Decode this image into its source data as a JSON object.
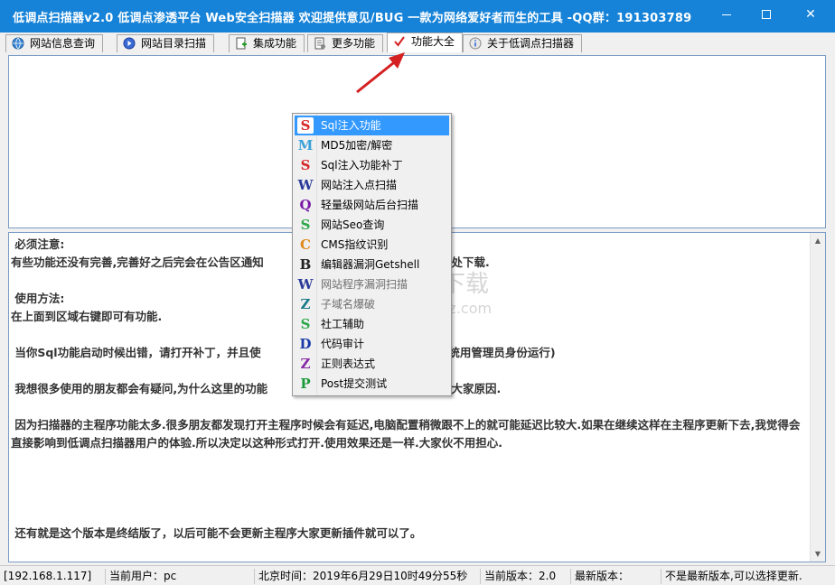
{
  "window": {
    "title": "低调点扫描器v2.0 低调点渗透平台 Web安全扫描器 欢迎提供意见/BUG  一款为网络爱好者而生的工具   -QQ群：191303789"
  },
  "tabs": [
    {
      "label": "网站信息查询",
      "icon": "globe-icon"
    },
    {
      "label": "网站目录扫描",
      "icon": "play-circle-icon"
    },
    {
      "label": "集成功能",
      "icon": "document-add-icon"
    },
    {
      "label": "更多功能",
      "icon": "document-gear-icon"
    },
    {
      "label": "功能大全",
      "icon": "checkmark-icon",
      "active": true
    },
    {
      "label": "关于低调点扫描器",
      "icon": "info-icon"
    }
  ],
  "notice": {
    "text": " 必须注意:\n有些功能还没有完善,完善好之后完会在公告区通知                                          更新处下载.\n\n 使用方法:\n在上面到区域右键即可有功能.\n\n 当你Sql功能启动时候出错，请打开补丁，并且使                                          上系统用管理员身份运行)\n\n 我想很多使用的朋友都会有疑问,为什么这里的功能                                         告诉大家原因.\n\n 因为扫描器的主程序功能太多.很多朋友都发现打开主程序时候会有延迟,电脑配置稍微跟不上的就可能延迟比较大.如果在继续这样在主程序更新下去,我觉得会直接影响到低调点扫描器用户的体验.所以决定以这种形式打开.使用效果还是一样.大家伙不用担心.\n\n\n\n\n 还有就是这个版本是终结版了，以后可能不会更新主程序大家更新插件就可以了。"
  },
  "context_menu": {
    "items": [
      {
        "label": "Sql注入功能",
        "icon": "s-letter-icon",
        "glyph": "S",
        "color": "#d62828",
        "highlighted": true
      },
      {
        "label": "MD5加密/解密",
        "icon": "m-letter-icon",
        "glyph": "M",
        "color": "#3aa0d8"
      },
      {
        "label": "Sql注入功能补丁",
        "icon": "s-letter-icon",
        "glyph": "S",
        "color": "#d62828"
      },
      {
        "label": "网站注入点扫描",
        "icon": "w-letter-icon",
        "glyph": "W",
        "color": "#2a3a9a"
      },
      {
        "label": "轻量级网站后台扫描",
        "icon": "q-letter-icon",
        "glyph": "Q",
        "color": "#7a1aa8"
      },
      {
        "label": "网站Seo查询",
        "icon": "s-letter-icon",
        "glyph": "S",
        "color": "#2ea84a"
      },
      {
        "label": "CMS指纹识别",
        "icon": "c-letter-icon",
        "glyph": "C",
        "color": "#e08a1a"
      },
      {
        "label": "编辑器漏洞Getshell",
        "icon": "b-letter-icon",
        "glyph": "B",
        "color": "#222222"
      },
      {
        "label": "网站程序漏洞扫描",
        "icon": "w-letter-icon",
        "glyph": "W",
        "color": "#2a3a9a"
      },
      {
        "label": "子域名爆破",
        "icon": "z-letter-icon",
        "glyph": "Z",
        "color": "#1a7a8a"
      },
      {
        "label": "社工辅助",
        "icon": "s-letter-icon",
        "glyph": "S",
        "color": "#2ea84a"
      },
      {
        "label": "代码审计",
        "icon": "d-letter-icon",
        "glyph": "D",
        "color": "#1a3aa8"
      },
      {
        "label": "正则表达式",
        "icon": "z-letter-icon",
        "glyph": "Z",
        "color": "#8a2aa8"
      },
      {
        "label": "Post提交测试",
        "icon": "p-letter-icon",
        "glyph": "P",
        "color": "#1a9a3a"
      }
    ]
  },
  "watermark": {
    "brand": "安下载",
    "domain": "anxz.com"
  },
  "statusbar": {
    "ip": "[192.168.1.117]",
    "user": "当前用户：pc",
    "time": "北京时间：2019年6月29日10时49分55秒",
    "version": "当前版本：2.0",
    "latest": "最新版本：",
    "update_note": "不是最新版本,可以选择更新."
  },
  "colors": {
    "titlebar": "#1683d8",
    "highlight": "#3399ff",
    "panel_border": "#7a9cc4",
    "arrow": "#d42020"
  }
}
